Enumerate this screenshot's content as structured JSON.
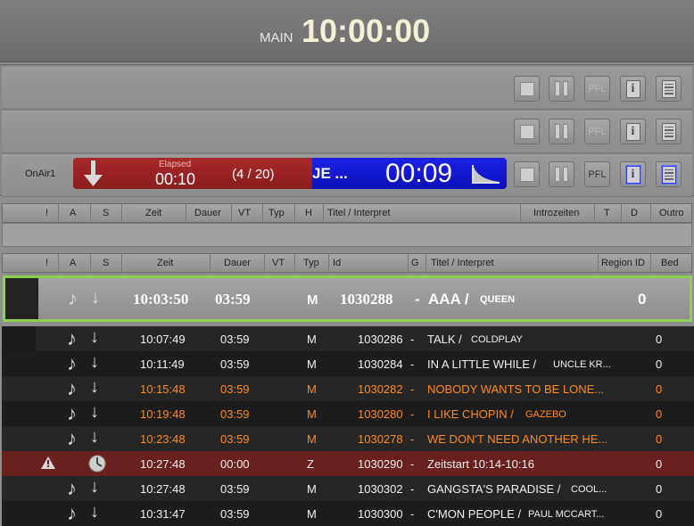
{
  "header": {
    "label": "MAIN",
    "clock": "10:00:00"
  },
  "player": {
    "name": "OnAir1",
    "elapsed_label": "Elapsed",
    "elapsed": "00:10",
    "count": "(4 / 20)",
    "title": "JE ...",
    "remaining": "00:09",
    "pfl_label": "PFL"
  },
  "table1": {
    "headers": [
      "!",
      "A",
      "S",
      "Zeit",
      "Dauer",
      "VT",
      "Typ",
      "H",
      "Titel / Interpret",
      "Introzeiten",
      "T",
      "D",
      "Outro"
    ]
  },
  "table2": {
    "headers": [
      "!",
      "A",
      "S",
      "Zeit",
      "Dauer",
      "VT",
      "Typ",
      "Id",
      "G",
      "Titel / Interpret",
      "Region ID",
      "Bed"
    ]
  },
  "current": {
    "time": "10:03:50",
    "dur": "03:59",
    "type": "M",
    "id": "1030288",
    "dash": "-",
    "title": "AAA /",
    "artist": "QUEEN",
    "region": "0"
  },
  "rows": [
    {
      "time": "10:07:49",
      "dur": "03:59",
      "type": "M",
      "id": "1030286",
      "dash": "-",
      "title": "TALK /",
      "artist": "COLDPLAY",
      "region": "0"
    },
    {
      "time": "10:11:49",
      "dur": "03:59",
      "type": "M",
      "id": "1030284",
      "dash": "-",
      "title": "IN A LITTLE WHILE /",
      "artist": "UNCLE KR...",
      "region": "0"
    },
    {
      "time": "10:15:48",
      "dur": "03:59",
      "type": "M",
      "id": "1030282",
      "dash": "-",
      "title": "NOBODY WANTS TO BE LONE...",
      "artist": "",
      "region": "0"
    },
    {
      "time": "10:19:48",
      "dur": "03:59",
      "type": "M",
      "id": "1030280",
      "dash": "-",
      "title": "I LIKE CHOPIN /",
      "artist": "GAZEBO",
      "region": "0"
    },
    {
      "time": "10:23:48",
      "dur": "03:59",
      "type": "M",
      "id": "1030278",
      "dash": "-",
      "title": "WE DON'T NEED ANOTHER HE...",
      "artist": "",
      "region": "0"
    },
    {
      "time": "10:27:48",
      "dur": "00:00",
      "type": "Z",
      "id": "1030290",
      "dash": "-",
      "title": "Zeitstart 10:14-10:16",
      "artist": "",
      "region": "0"
    },
    {
      "time": "10:27:48",
      "dur": "03:59",
      "type": "M",
      "id": "1030302",
      "dash": "-",
      "title": "GANGSTA'S PARADISE /",
      "artist": "COOL...",
      "region": "0"
    },
    {
      "time": "10:31:47",
      "dur": "03:59",
      "type": "M",
      "id": "1030300",
      "dash": "-",
      "title": "C'MON PEOPLE /",
      "artist": "PAUL MCCART...",
      "region": "0"
    }
  ],
  "colors": {
    "highlight_border": "#8fd050",
    "orange_text": "#ff8a1e",
    "player_blue": "#1c22e8",
    "player_red": "#a82a2a",
    "timer_row": "#6b2020"
  }
}
